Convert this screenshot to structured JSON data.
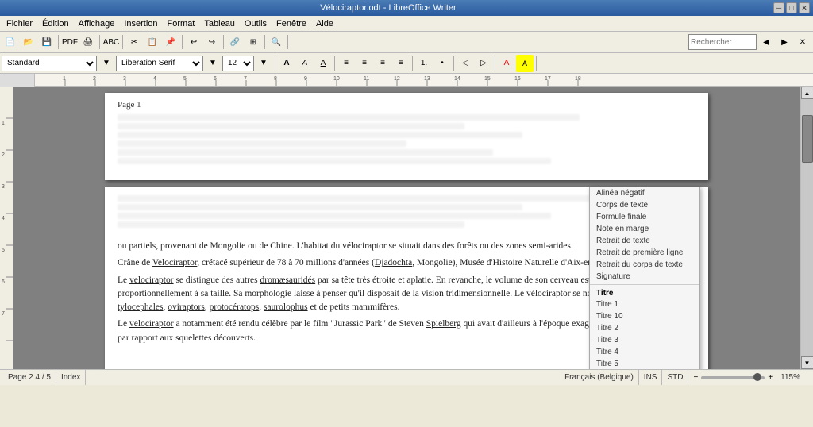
{
  "titlebar": {
    "title": "Vélociraptor.odt - LibreOffice Writer",
    "min": "─",
    "max": "□",
    "close": "✕"
  },
  "menubar": {
    "items": [
      "Fichier",
      "Édition",
      "Affichage",
      "Insertion",
      "Format",
      "Tableau",
      "Outils",
      "Fenêtre",
      "Aide"
    ]
  },
  "toolbar": {
    "search_placeholder": "Rechercher"
  },
  "formatting": {
    "style": "Standard",
    "font": "Liberation Serif",
    "size": "12"
  },
  "dropdown_menu": {
    "items": [
      {
        "label": "Alinéa négatif",
        "type": "item"
      },
      {
        "label": "Corps de texte",
        "type": "item"
      },
      {
        "label": "Formule finale",
        "type": "item"
      },
      {
        "label": "Note en marge",
        "type": "item"
      },
      {
        "label": "Retrait de texte",
        "type": "item"
      },
      {
        "label": "Retrait de première ligne",
        "type": "item"
      },
      {
        "label": "Retrait du corps de texte",
        "type": "item"
      },
      {
        "label": "Signature",
        "type": "item"
      },
      {
        "label": "sep1",
        "type": "sep"
      },
      {
        "label": "Titre",
        "type": "heading"
      },
      {
        "label": "Titre 1",
        "type": "item"
      },
      {
        "label": "Titre 10",
        "type": "item"
      },
      {
        "label": "Titre 2",
        "type": "item"
      },
      {
        "label": "Titre 3",
        "type": "item"
      },
      {
        "label": "Titre 4",
        "type": "item"
      },
      {
        "label": "Titre 5",
        "type": "item"
      },
      {
        "label": "sep2",
        "type": "sep"
      },
      {
        "label": "Titre 5",
        "type": "item"
      }
    ]
  },
  "page1": {
    "label": "Page 1",
    "content_blurred": true
  },
  "page2": {
    "paragraphs": [
      "ou partiels, provenant de Mongolie ou de Chine. L'habitat du vélociraptor se situait dans des forêts ou des zones semi-arides.",
      "Crâne de Velociraptor, crétacé supérieur de 78 à 70 millions d'années (Djadochta, Mongolie), Musée d'Histoire Naturelle d'Aix-en-Provence",
      "Le velociraptor se distingue des autres dromæsauridés par sa tête très étroite et aplatie. En revanche, le volume de son cerveau est relativement important proportionnellement à sa taille. Sa morphologie laisse à penser qu'il disposait de la vision tridimensionnelle. Le vélociraptor se nourrissait sans doute de tylocephales, oviraptors, protocératops, saurolophus et de petits mammifères.",
      "Le velociraptor a notamment été rendu célèbre par le film \"Jurassic Park\" de Steven Spielberg qui avait d'ailleurs à l'époque exagéré la taille de ces animaux par rapport aux squelettes découverts."
    ]
  },
  "statusbar": {
    "page_info": "Page 2  4 / 5",
    "index": "Index",
    "language": "Français (Belgique)",
    "ins": "INS",
    "std": "STD",
    "zoom_percent": "115%"
  }
}
